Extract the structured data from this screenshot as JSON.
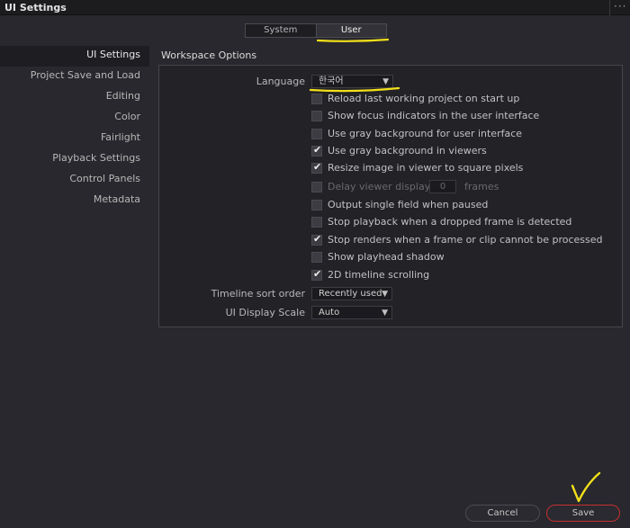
{
  "window": {
    "title": "UI Settings",
    "menu_glyph": "···"
  },
  "tabs": [
    {
      "label": "System",
      "active": false
    },
    {
      "label": "User",
      "active": true
    }
  ],
  "sidebar": {
    "items": [
      {
        "label": "UI Settings",
        "active": true
      },
      {
        "label": "Project Save and Load"
      },
      {
        "label": "Editing"
      },
      {
        "label": "Color"
      },
      {
        "label": "Fairlight"
      },
      {
        "label": "Playback Settings"
      },
      {
        "label": "Control Panels"
      },
      {
        "label": "Metadata"
      }
    ]
  },
  "workspace": {
    "title": "Workspace Options",
    "language": {
      "label": "Language",
      "value": "한국어"
    },
    "options": [
      {
        "label": "Reload last working project on start up",
        "checked": false
      },
      {
        "label": "Show focus indicators in the user interface",
        "checked": false
      },
      {
        "label": "Use gray background for user interface",
        "checked": false
      },
      {
        "label": "Use gray background in viewers",
        "checked": true
      },
      {
        "label": "Resize image in viewer to square pixels",
        "checked": true
      },
      {
        "label": "Delay viewer display by",
        "checked": false,
        "disabled": true,
        "input_value": "0",
        "suffix": "frames"
      },
      {
        "label": "Output single field when paused",
        "checked": false
      },
      {
        "label": "Stop playback when a dropped frame is detected",
        "checked": false
      },
      {
        "label": "Stop renders when a frame or clip cannot be processed",
        "checked": true
      },
      {
        "label": "Show playhead shadow",
        "checked": false
      },
      {
        "label": "2D timeline scrolling",
        "checked": true
      }
    ],
    "timeline_sort": {
      "label": "Timeline sort order",
      "value": "Recently used"
    },
    "ui_scale": {
      "label": "UI Display Scale",
      "value": "Auto"
    }
  },
  "footer": {
    "cancel_label": "Cancel",
    "save_label": "Save"
  },
  "annotation_color": "#f2df1a",
  "accent_red": "#c53030"
}
